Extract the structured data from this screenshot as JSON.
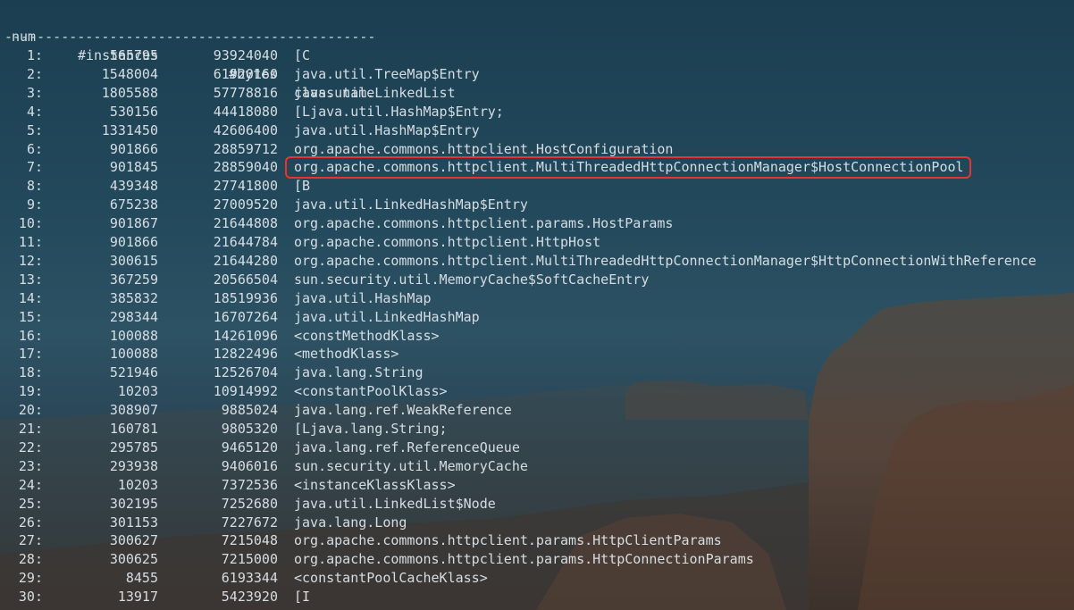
{
  "header": {
    "num": "num",
    "instances": "#instances",
    "bytes": "#bytes",
    "class_name": "class name",
    "separator": "----------------------------------------------"
  },
  "highlight_color": "#e8342c",
  "rows": [
    {
      "num": "1:",
      "instances": "565795",
      "bytes": "93924040",
      "class": "[C"
    },
    {
      "num": "2:",
      "instances": "1548004",
      "bytes": "61920160",
      "class": "java.util.TreeMap$Entry"
    },
    {
      "num": "3:",
      "instances": "1805588",
      "bytes": "57778816",
      "class": "java.util.LinkedList"
    },
    {
      "num": "4:",
      "instances": "530156",
      "bytes": "44418080",
      "class": "[Ljava.util.HashMap$Entry;"
    },
    {
      "num": "5:",
      "instances": "1331450",
      "bytes": "42606400",
      "class": "java.util.HashMap$Entry"
    },
    {
      "num": "6:",
      "instances": "901866",
      "bytes": "28859712",
      "class": "org.apache.commons.httpclient.HostConfiguration"
    },
    {
      "num": "7:",
      "instances": "901845",
      "bytes": "28859040",
      "class": "org.apache.commons.httpclient.MultiThreadedHttpConnectionManager$HostConnectionPool",
      "highlighted": true
    },
    {
      "num": "8:",
      "instances": "439348",
      "bytes": "27741800",
      "class": "[B"
    },
    {
      "num": "9:",
      "instances": "675238",
      "bytes": "27009520",
      "class": "java.util.LinkedHashMap$Entry"
    },
    {
      "num": "10:",
      "instances": "901867",
      "bytes": "21644808",
      "class": "org.apache.commons.httpclient.params.HostParams"
    },
    {
      "num": "11:",
      "instances": "901866",
      "bytes": "21644784",
      "class": "org.apache.commons.httpclient.HttpHost"
    },
    {
      "num": "12:",
      "instances": "300615",
      "bytes": "21644280",
      "class": "org.apache.commons.httpclient.MultiThreadedHttpConnectionManager$HttpConnectionWithReference"
    },
    {
      "num": "13:",
      "instances": "367259",
      "bytes": "20566504",
      "class": "sun.security.util.MemoryCache$SoftCacheEntry"
    },
    {
      "num": "14:",
      "instances": "385832",
      "bytes": "18519936",
      "class": "java.util.HashMap"
    },
    {
      "num": "15:",
      "instances": "298344",
      "bytes": "16707264",
      "class": "java.util.LinkedHashMap"
    },
    {
      "num": "16:",
      "instances": "100088",
      "bytes": "14261096",
      "class": "<constMethodKlass>"
    },
    {
      "num": "17:",
      "instances": "100088",
      "bytes": "12822496",
      "class": "<methodKlass>"
    },
    {
      "num": "18:",
      "instances": "521946",
      "bytes": "12526704",
      "class": "java.lang.String"
    },
    {
      "num": "19:",
      "instances": "10203",
      "bytes": "10914992",
      "class": "<constantPoolKlass>"
    },
    {
      "num": "20:",
      "instances": "308907",
      "bytes": "9885024",
      "class": "java.lang.ref.WeakReference"
    },
    {
      "num": "21:",
      "instances": "160781",
      "bytes": "9805320",
      "class": "[Ljava.lang.String;"
    },
    {
      "num": "22:",
      "instances": "295785",
      "bytes": "9465120",
      "class": "java.lang.ref.ReferenceQueue"
    },
    {
      "num": "23:",
      "instances": "293938",
      "bytes": "9406016",
      "class": "sun.security.util.MemoryCache"
    },
    {
      "num": "24:",
      "instances": "10203",
      "bytes": "7372536",
      "class": "<instanceKlassKlass>"
    },
    {
      "num": "25:",
      "instances": "302195",
      "bytes": "7252680",
      "class": "java.util.LinkedList$Node"
    },
    {
      "num": "26:",
      "instances": "301153",
      "bytes": "7227672",
      "class": "java.lang.Long"
    },
    {
      "num": "27:",
      "instances": "300627",
      "bytes": "7215048",
      "class": "org.apache.commons.httpclient.params.HttpClientParams"
    },
    {
      "num": "28:",
      "instances": "300625",
      "bytes": "7215000",
      "class": "org.apache.commons.httpclient.params.HttpConnectionParams"
    },
    {
      "num": "29:",
      "instances": "8455",
      "bytes": "6193344",
      "class": "<constantPoolCacheKlass>"
    },
    {
      "num": "30:",
      "instances": "13917",
      "bytes": "5423920",
      "class": "[I"
    }
  ]
}
